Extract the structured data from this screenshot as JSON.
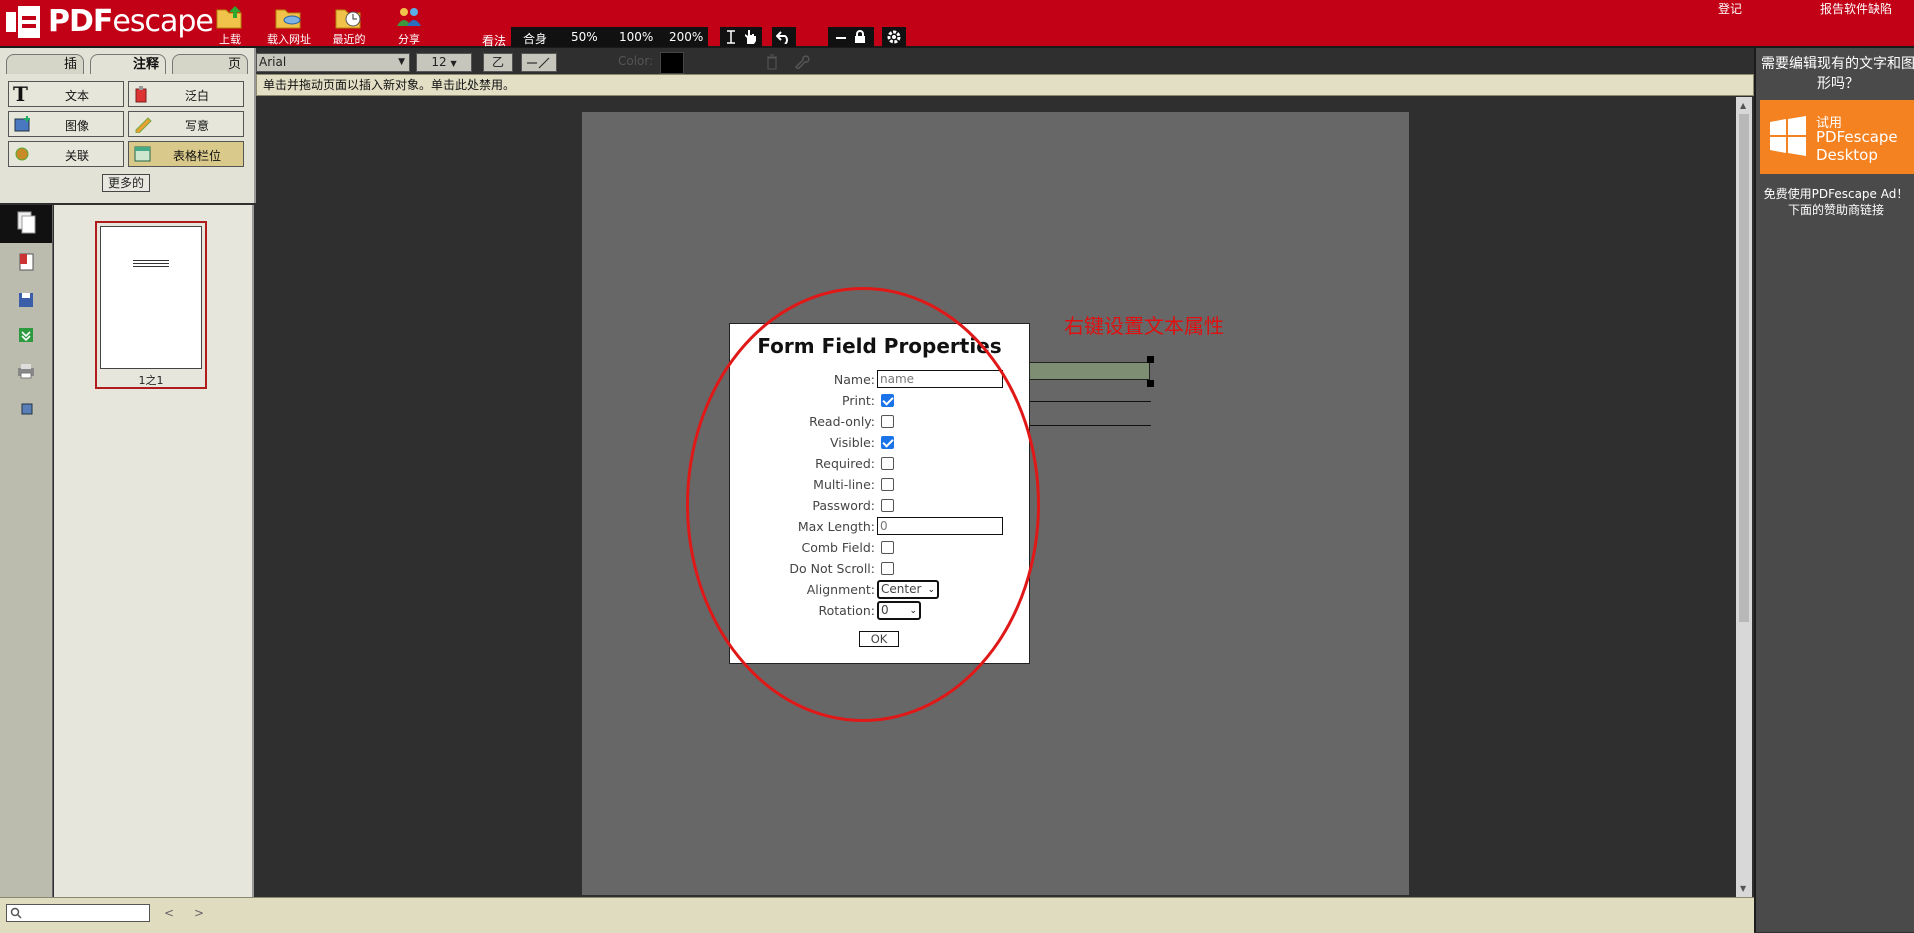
{
  "app": {
    "logo_text_bold": "PDF",
    "logo_text_rest": "escape"
  },
  "topbar": {
    "buttons": [
      {
        "label": "上载",
        "icon": "upload-folder-icon"
      },
      {
        "label": "载入网址",
        "icon": "load-url-folder-icon"
      },
      {
        "label": "最近的",
        "icon": "recent-clock-icon"
      },
      {
        "label": "分享",
        "icon": "share-users-icon"
      }
    ],
    "view_label": "看法",
    "zoom_options": [
      "合身",
      "50%",
      "100%",
      "200%"
    ],
    "login": "登记",
    "report_bug": "报告软件缺陷"
  },
  "left_tabs": [
    "插",
    "注释",
    "页"
  ],
  "tools": [
    {
      "label": "文本",
      "icon": "text-t-icon"
    },
    {
      "label": "泛白",
      "icon": "whiteout-icon"
    },
    {
      "label": "图像",
      "icon": "image-icon"
    },
    {
      "label": "写意",
      "icon": "freehand-pencil-icon"
    },
    {
      "label": "关联",
      "icon": "link-icon"
    },
    {
      "label": "表格栏位",
      "icon": "form-field-icon"
    }
  ],
  "more_label": "更多的",
  "thumbnail": {
    "label": "1之1"
  },
  "font_toolbar": {
    "font": "Arial",
    "size": "12",
    "color_label": "Color:",
    "accent_color": "#000000"
  },
  "info_bar": "单击并拖动页面以插入新对象。单击此处禁用。",
  "annotation": "右键设置文本属性",
  "dialog": {
    "title": "Form Field Properties",
    "name_label": "Name:",
    "name_placeholder": "name",
    "checkboxes": [
      {
        "label": "Print:",
        "checked": true
      },
      {
        "label": "Read-only:",
        "checked": false
      },
      {
        "label": "Visible:",
        "checked": true
      },
      {
        "label": "Required:",
        "checked": false
      },
      {
        "label": "Multi-line:",
        "checked": false
      },
      {
        "label": "Password:",
        "checked": false
      }
    ],
    "max_length_label": "Max Length:",
    "max_length_value": "0",
    "checkboxes2": [
      {
        "label": "Comb Field:",
        "checked": false
      },
      {
        "label": "Do Not Scroll:",
        "checked": false
      }
    ],
    "alignment_label": "Alignment:",
    "alignment_value": "Center",
    "rotation_label": "Rotation:",
    "rotation_value": "0",
    "ok_label": "OK"
  },
  "bottom": {
    "prev": "<",
    "next": ">"
  },
  "ad": {
    "question": "需要编辑现有的文字和图形吗？",
    "try_label": "试用",
    "product": "PDFescape Desktop",
    "free_line1": "免费使用PDFescape Ad！",
    "free_line2": "下面的赞助商链接",
    "brand_color": "#f58220"
  }
}
